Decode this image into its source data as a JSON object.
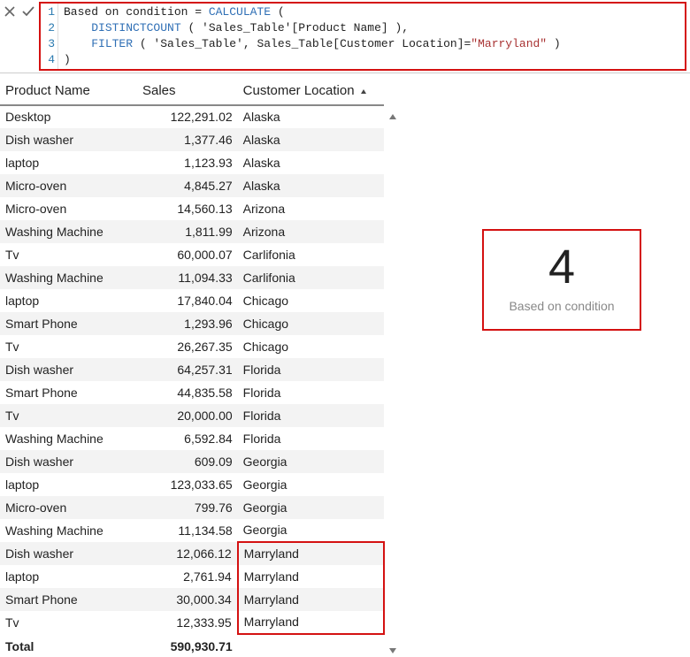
{
  "formula": {
    "line_numbers": [
      "1",
      "2",
      "3",
      "4"
    ],
    "html": "<span class='tok-plain'>Based on condition = </span><span class='tok-kw'>CALCULATE</span><span class='tok-plain'> (</span>\n<span class='tok-plain'>    </span><span class='tok-kw'>DISTINCTCOUNT</span><span class='tok-plain'> ( 'Sales_Table'[Product Name] ),</span>\n<span class='tok-plain'>    </span><span class='tok-kw'>FILTER</span><span class='tok-plain'> ( 'Sales_Table', Sales_Table[Customer Location]=</span><span class='tok-str'>\"Marryland\"</span><span class='tok-plain'> )</span>\n<span class='tok-plain'>)</span>"
  },
  "table": {
    "headers": {
      "product": "Product Name",
      "sales": "Sales",
      "location": "Customer Location"
    },
    "sort_column": "location",
    "rows": [
      {
        "product": "Desktop",
        "sales": "122,291.02",
        "location": "Alaska"
      },
      {
        "product": "Dish washer",
        "sales": "1,377.46",
        "location": "Alaska"
      },
      {
        "product": "laptop",
        "sales": "1,123.93",
        "location": "Alaska"
      },
      {
        "product": "Micro-oven",
        "sales": "4,845.27",
        "location": "Alaska"
      },
      {
        "product": "Micro-oven",
        "sales": "14,560.13",
        "location": "Arizona"
      },
      {
        "product": "Washing Machine",
        "sales": "1,811.99",
        "location": "Arizona"
      },
      {
        "product": "Tv",
        "sales": "60,000.07",
        "location": "Carlifonia"
      },
      {
        "product": "Washing Machine",
        "sales": "11,094.33",
        "location": "Carlifonia"
      },
      {
        "product": "laptop",
        "sales": "17,840.04",
        "location": "Chicago"
      },
      {
        "product": "Smart Phone",
        "sales": "1,293.96",
        "location": "Chicago"
      },
      {
        "product": "Tv",
        "sales": "26,267.35",
        "location": "Chicago"
      },
      {
        "product": "Dish washer",
        "sales": "64,257.31",
        "location": "Florida"
      },
      {
        "product": "Smart Phone",
        "sales": "44,835.58",
        "location": "Florida"
      },
      {
        "product": "Tv",
        "sales": "20,000.00",
        "location": "Florida"
      },
      {
        "product": "Washing Machine",
        "sales": "6,592.84",
        "location": "Florida"
      },
      {
        "product": "Dish washer",
        "sales": "609.09",
        "location": "Georgia"
      },
      {
        "product": "laptop",
        "sales": "123,033.65",
        "location": "Georgia"
      },
      {
        "product": "Micro-oven",
        "sales": "799.76",
        "location": "Georgia"
      },
      {
        "product": "Washing Machine",
        "sales": "11,134.58",
        "location": "Georgia"
      },
      {
        "product": "Dish washer",
        "sales": "12,066.12",
        "location": "Marryland",
        "hi": true
      },
      {
        "product": "laptop",
        "sales": "2,761.94",
        "location": "Marryland",
        "hi": true
      },
      {
        "product": "Smart Phone",
        "sales": "30,000.34",
        "location": "Marryland",
        "hi": true
      },
      {
        "product": "Tv",
        "sales": "12,333.95",
        "location": "Marryland",
        "hi": true
      }
    ],
    "total": {
      "label": "Total",
      "sales": "590,930.71"
    }
  },
  "card": {
    "value": "4",
    "label": "Based on condition"
  }
}
